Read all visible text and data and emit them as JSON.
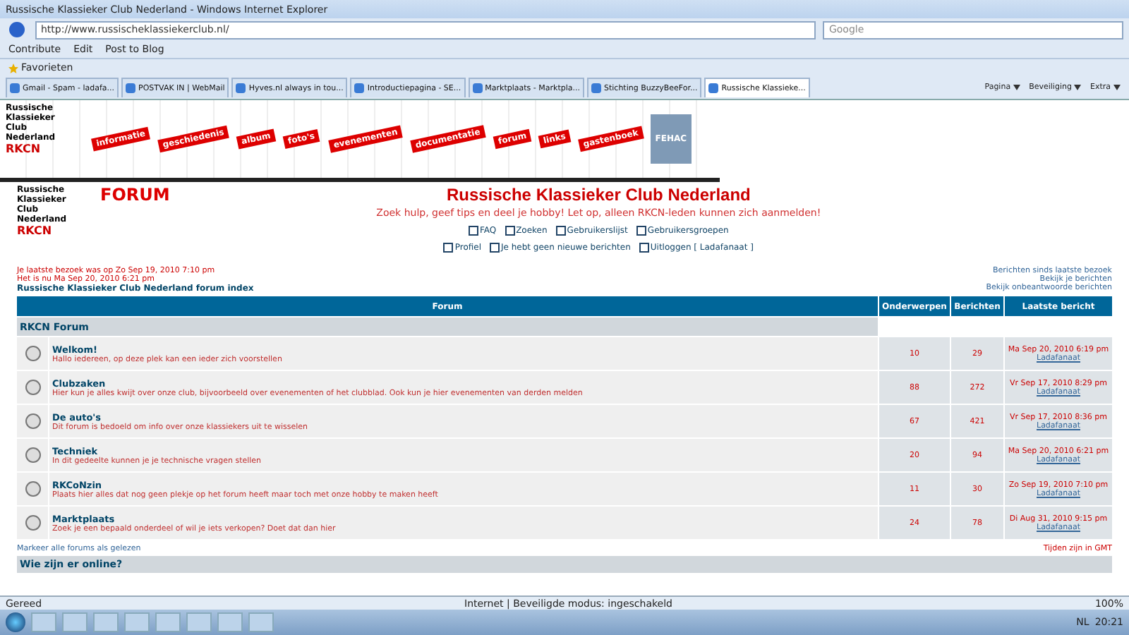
{
  "window": {
    "title": "Russische Klassieker Club Nederland - Windows Internet Explorer"
  },
  "address_bar": {
    "url": "http://www.russischeklassiekerclub.nl/",
    "search_placeholder": "Google"
  },
  "links_bar": [
    {
      "label": "Contribute"
    },
    {
      "label": "Edit"
    },
    {
      "label": "Post to Blog"
    }
  ],
  "favorites_bar": {
    "label": "Favorieten"
  },
  "tabs": [
    {
      "label": "Gmail - Spam - ladafa...",
      "selected": false
    },
    {
      "label": "POSTVAK IN | WebMail",
      "selected": false
    },
    {
      "label": "Hyves.nl always in tou...",
      "selected": false
    },
    {
      "label": "Introductiepagina - SE...",
      "selected": false
    },
    {
      "label": "Marktplaats - Marktpla...",
      "selected": false
    },
    {
      "label": "Stichting BuzzyBeeFor...",
      "selected": false
    },
    {
      "label": "Russische Klassieke...",
      "selected": true
    }
  ],
  "command_bar": [
    "Pagina",
    "Beveiliging",
    "Extra"
  ],
  "banner": {
    "logo_text": "Russische Klassieker Club Nederland",
    "logo_mark": "RKCN",
    "nav": [
      "informatie",
      "geschiedenis",
      "album",
      "foto's",
      "evenementen",
      "documentatie",
      "forum",
      "links",
      "gastenboek"
    ],
    "badge": "FEHAC"
  },
  "forum_header": {
    "logo_text": "Russische Klassieker Club Nederland",
    "logo_mark": "RKCN",
    "label": "FORUM",
    "title": "Russische Klassieker Club Nederland",
    "subtitle": "Zoek hulp, geef tips en deel je hobby! Let op, alleen RKCN-leden kunnen zich aanmelden!",
    "links_row_1": [
      "FAQ",
      "Zoeken",
      "Gebruikerslijst",
      "Gebruikersgroepen"
    ],
    "links_row_2": [
      "Profiel",
      "Je hebt geen nieuwe berichten",
      "Uitloggen [ Ladafanaat ]"
    ]
  },
  "info": {
    "last_visit": "Je laatste bezoek was op Zo Sep 19, 2010 7:10 pm",
    "now": "Het is nu Ma Sep 20, 2010 6:21 pm",
    "breadcrumb": "Russische Klassieker Club Nederland forum index",
    "right_links": [
      "Berichten sinds laatste bezoek",
      "Bekijk je berichten",
      "Bekijk onbeantwoorde berichten"
    ]
  },
  "table": {
    "columns": [
      "Forum",
      "Onderwerpen",
      "Berichten",
      "Laatste bericht"
    ],
    "category": "RKCN Forum",
    "rows": [
      {
        "name": "Welkom!",
        "description": "Hallo iedereen, op deze plek kan een ieder zich voorstellen",
        "topics": "10",
        "posts": "29",
        "last_post": "Ma Sep 20, 2010 6:19 pm",
        "last_user": "Ladafanaat"
      },
      {
        "name": "Clubzaken",
        "description": "Hier kun je alles kwijt over onze club, bijvoorbeeld over evenementen of het clubblad. Ook kun je hier evenementen van derden melden",
        "topics": "88",
        "posts": "272",
        "last_post": "Vr Sep 17, 2010 8:29 pm",
        "last_user": "Ladafanaat"
      },
      {
        "name": "De auto's",
        "description": "Dit forum is bedoeld om info over onze klassiekers uit te wisselen",
        "topics": "67",
        "posts": "421",
        "last_post": "Vr Sep 17, 2010 8:36 pm",
        "last_user": "Ladafanaat"
      },
      {
        "name": "Techniek",
        "description": "In dit gedeelte kunnen je je technische vragen stellen",
        "topics": "20",
        "posts": "94",
        "last_post": "Ma Sep 20, 2010 6:21 pm",
        "last_user": "Ladafanaat"
      },
      {
        "name": "RKCoNzin",
        "description": "Plaats hier alles dat nog geen plekje op het forum heeft maar toch met onze hobby te maken heeft",
        "topics": "11",
        "posts": "30",
        "last_post": "Zo Sep 19, 2010 7:10 pm",
        "last_user": "Ladafanaat"
      },
      {
        "name": "Marktplaats",
        "description": "Zoek je een bepaald onderdeel of wil je iets verkopen? Doet dat dan hier",
        "topics": "24",
        "posts": "78",
        "last_post": "Di Aug 31, 2010 9:15 pm",
        "last_user": "Ladafanaat"
      }
    ]
  },
  "footer": {
    "mark_read": "Markeer alle forums als gelezen",
    "timezone": "Tijden zijn in GMT",
    "online_heading": "Wie zijn er online?"
  },
  "status_bar": {
    "left": "Gereed",
    "zone": "Internet | Beveiligde modus: ingeschakeld",
    "zoom": "100%"
  },
  "taskbar": {
    "language": "NL",
    "time": "20:21"
  }
}
